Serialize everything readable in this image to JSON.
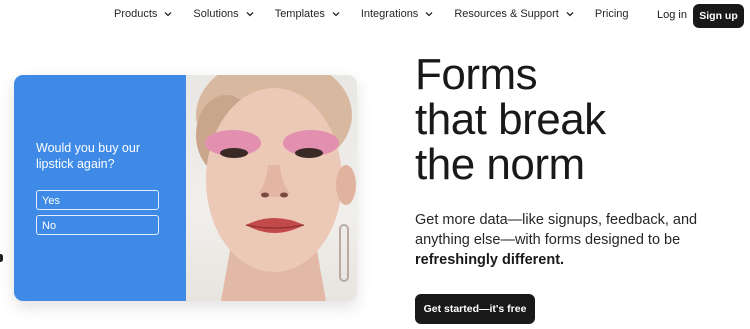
{
  "nav": {
    "items": [
      {
        "label": "Products",
        "has_dropdown": true
      },
      {
        "label": "Solutions",
        "has_dropdown": true
      },
      {
        "label": "Templates",
        "has_dropdown": true
      },
      {
        "label": "Integrations",
        "has_dropdown": true
      },
      {
        "label": "Resources & Support",
        "has_dropdown": true
      },
      {
        "label": "Pricing",
        "has_dropdown": false
      }
    ],
    "login_label": "Log in",
    "signup_label": "Sign up"
  },
  "hero_card": {
    "question": "Would you buy our lipstick again?",
    "choices": [
      "Yes",
      "No"
    ],
    "accent_color": "#3e8ae6",
    "image_subject": "portrait-pink-eyeshadow-earring"
  },
  "hero": {
    "headline_lines": [
      "Forms",
      "that break",
      "the norm"
    ],
    "subtext_plain": "Get more data—like signups, feedback, and anything else—with forms designed to be",
    "subtext_bold": "refreshingly different.",
    "cta_label": "Get started—it's free"
  },
  "colors": {
    "primary_dark": "#191919",
    "text": "#262627",
    "background": "#ffffff"
  }
}
